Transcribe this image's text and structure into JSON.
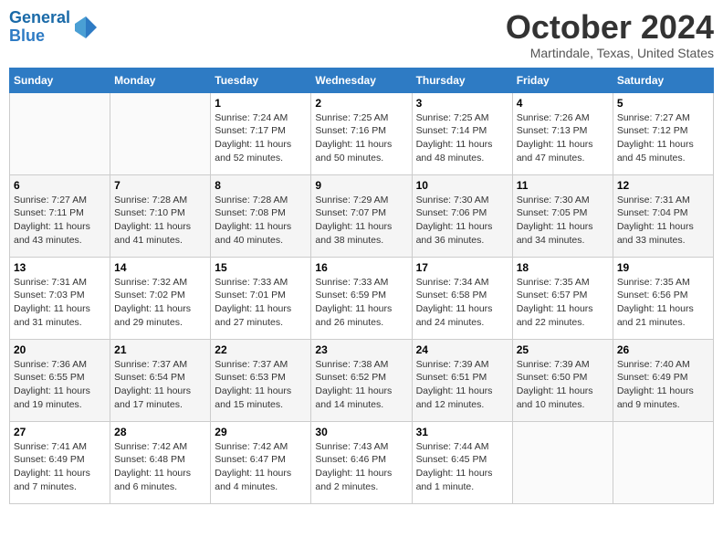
{
  "logo": {
    "line1": "General",
    "line2": "Blue"
  },
  "title": "October 2024",
  "subtitle": "Martindale, Texas, United States",
  "days_of_week": [
    "Sunday",
    "Monday",
    "Tuesday",
    "Wednesday",
    "Thursday",
    "Friday",
    "Saturday"
  ],
  "weeks": [
    [
      {
        "day": "",
        "info": ""
      },
      {
        "day": "",
        "info": ""
      },
      {
        "day": "1",
        "info": "Sunrise: 7:24 AM\nSunset: 7:17 PM\nDaylight: 11 hours\nand 52 minutes."
      },
      {
        "day": "2",
        "info": "Sunrise: 7:25 AM\nSunset: 7:16 PM\nDaylight: 11 hours\nand 50 minutes."
      },
      {
        "day": "3",
        "info": "Sunrise: 7:25 AM\nSunset: 7:14 PM\nDaylight: 11 hours\nand 48 minutes."
      },
      {
        "day": "4",
        "info": "Sunrise: 7:26 AM\nSunset: 7:13 PM\nDaylight: 11 hours\nand 47 minutes."
      },
      {
        "day": "5",
        "info": "Sunrise: 7:27 AM\nSunset: 7:12 PM\nDaylight: 11 hours\nand 45 minutes."
      }
    ],
    [
      {
        "day": "6",
        "info": "Sunrise: 7:27 AM\nSunset: 7:11 PM\nDaylight: 11 hours\nand 43 minutes."
      },
      {
        "day": "7",
        "info": "Sunrise: 7:28 AM\nSunset: 7:10 PM\nDaylight: 11 hours\nand 41 minutes."
      },
      {
        "day": "8",
        "info": "Sunrise: 7:28 AM\nSunset: 7:08 PM\nDaylight: 11 hours\nand 40 minutes."
      },
      {
        "day": "9",
        "info": "Sunrise: 7:29 AM\nSunset: 7:07 PM\nDaylight: 11 hours\nand 38 minutes."
      },
      {
        "day": "10",
        "info": "Sunrise: 7:30 AM\nSunset: 7:06 PM\nDaylight: 11 hours\nand 36 minutes."
      },
      {
        "day": "11",
        "info": "Sunrise: 7:30 AM\nSunset: 7:05 PM\nDaylight: 11 hours\nand 34 minutes."
      },
      {
        "day": "12",
        "info": "Sunrise: 7:31 AM\nSunset: 7:04 PM\nDaylight: 11 hours\nand 33 minutes."
      }
    ],
    [
      {
        "day": "13",
        "info": "Sunrise: 7:31 AM\nSunset: 7:03 PM\nDaylight: 11 hours\nand 31 minutes."
      },
      {
        "day": "14",
        "info": "Sunrise: 7:32 AM\nSunset: 7:02 PM\nDaylight: 11 hours\nand 29 minutes."
      },
      {
        "day": "15",
        "info": "Sunrise: 7:33 AM\nSunset: 7:01 PM\nDaylight: 11 hours\nand 27 minutes."
      },
      {
        "day": "16",
        "info": "Sunrise: 7:33 AM\nSunset: 6:59 PM\nDaylight: 11 hours\nand 26 minutes."
      },
      {
        "day": "17",
        "info": "Sunrise: 7:34 AM\nSunset: 6:58 PM\nDaylight: 11 hours\nand 24 minutes."
      },
      {
        "day": "18",
        "info": "Sunrise: 7:35 AM\nSunset: 6:57 PM\nDaylight: 11 hours\nand 22 minutes."
      },
      {
        "day": "19",
        "info": "Sunrise: 7:35 AM\nSunset: 6:56 PM\nDaylight: 11 hours\nand 21 minutes."
      }
    ],
    [
      {
        "day": "20",
        "info": "Sunrise: 7:36 AM\nSunset: 6:55 PM\nDaylight: 11 hours\nand 19 minutes."
      },
      {
        "day": "21",
        "info": "Sunrise: 7:37 AM\nSunset: 6:54 PM\nDaylight: 11 hours\nand 17 minutes."
      },
      {
        "day": "22",
        "info": "Sunrise: 7:37 AM\nSunset: 6:53 PM\nDaylight: 11 hours\nand 15 minutes."
      },
      {
        "day": "23",
        "info": "Sunrise: 7:38 AM\nSunset: 6:52 PM\nDaylight: 11 hours\nand 14 minutes."
      },
      {
        "day": "24",
        "info": "Sunrise: 7:39 AM\nSunset: 6:51 PM\nDaylight: 11 hours\nand 12 minutes."
      },
      {
        "day": "25",
        "info": "Sunrise: 7:39 AM\nSunset: 6:50 PM\nDaylight: 11 hours\nand 10 minutes."
      },
      {
        "day": "26",
        "info": "Sunrise: 7:40 AM\nSunset: 6:49 PM\nDaylight: 11 hours\nand 9 minutes."
      }
    ],
    [
      {
        "day": "27",
        "info": "Sunrise: 7:41 AM\nSunset: 6:49 PM\nDaylight: 11 hours\nand 7 minutes."
      },
      {
        "day": "28",
        "info": "Sunrise: 7:42 AM\nSunset: 6:48 PM\nDaylight: 11 hours\nand 6 minutes."
      },
      {
        "day": "29",
        "info": "Sunrise: 7:42 AM\nSunset: 6:47 PM\nDaylight: 11 hours\nand 4 minutes."
      },
      {
        "day": "30",
        "info": "Sunrise: 7:43 AM\nSunset: 6:46 PM\nDaylight: 11 hours\nand 2 minutes."
      },
      {
        "day": "31",
        "info": "Sunrise: 7:44 AM\nSunset: 6:45 PM\nDaylight: 11 hours\nand 1 minute."
      },
      {
        "day": "",
        "info": ""
      },
      {
        "day": "",
        "info": ""
      }
    ]
  ]
}
